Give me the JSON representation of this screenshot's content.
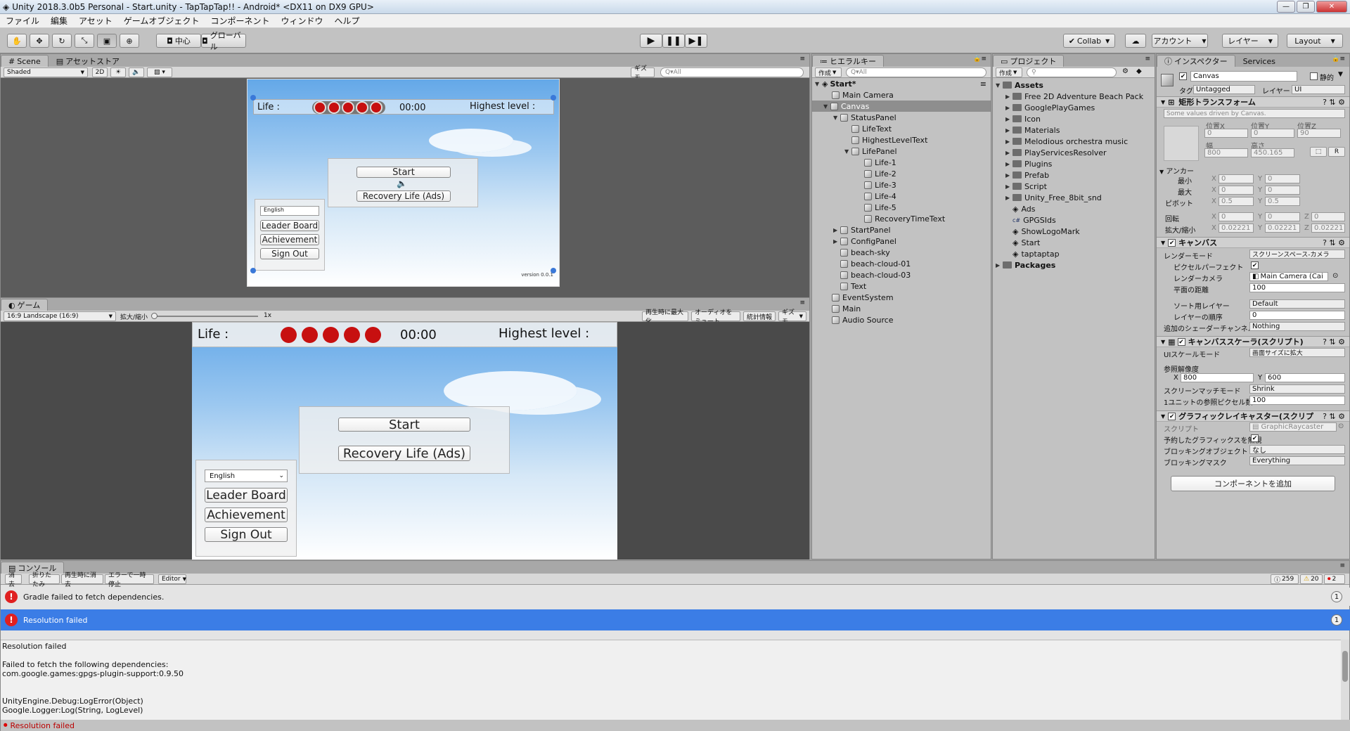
{
  "window": {
    "title": "Unity 2018.3.0b5 Personal - Start.unity - TapTapTap!! - Android* <DX11 on DX9 GPU>"
  },
  "menu": [
    "ファイル",
    "編集",
    "アセット",
    "ゲームオブジェクト",
    "コンポーネント",
    "ウィンドウ",
    "ヘルプ"
  ],
  "toolbar": {
    "pivot": "中心",
    "global": "グローバル",
    "collab": "Collab",
    "account": "アカウント",
    "layers": "レイヤー",
    "layout": "Layout"
  },
  "scene": {
    "tab_scene": "Scene",
    "tab_store": "アセットストア",
    "shading": "Shaded",
    "mode2d": "2D",
    "gizmos": "ギズモ",
    "search_placeholder": "Q▾All",
    "life_label": "Life :",
    "timer": "00:00",
    "highest": "Highest level :",
    "start": "Start",
    "recovery": "Recovery Life (Ads)",
    "language": "English",
    "leaderboard": "Leader Board",
    "achievement": "Achievement",
    "signout": "Sign Out",
    "version": "version 0.0.1"
  },
  "game": {
    "tab": "ゲーム",
    "resolution": "16:9 Landscape (16:9)",
    "scale_label": "拡大/縮小",
    "scale_value": "1x",
    "maximize": "再生時に最大化",
    "mute": "オーディオをミュート",
    "stats": "統計情報",
    "gizmos": "ギズモ",
    "life_label": "Life :",
    "timer": "00:00",
    "highest": "Highest level :",
    "start": "Start",
    "recovery": "Recovery Life (Ads)",
    "language": "English",
    "leaderboard": "Leader Board",
    "achievement": "Achievement",
    "signout": "Sign Out",
    "life_count": 5
  },
  "hierarchy": {
    "tab": "ヒエラルキー",
    "create": "作成",
    "search_placeholder": "Q▾All",
    "scene_name": "Start*",
    "items": [
      "Main Camera",
      "Canvas",
      "StatusPanel",
      "LifeText",
      "HighestLevelText",
      "LifePanel",
      "Life-1",
      "Life-2",
      "Life-3",
      "Life-4",
      "Life-5",
      "RecoveryTimeText",
      "StartPanel",
      "ConfigPanel",
      "beach-sky",
      "beach-cloud-01",
      "beach-cloud-03",
      "Text",
      "EventSystem",
      "Main",
      "Audio Source"
    ]
  },
  "project": {
    "tab": "プロジェクト",
    "create": "作成",
    "assets_label": "Assets",
    "packages_label": "Packages",
    "folders": [
      "Free 2D Adventure Beach Pack",
      "GooglePlayGames",
      "Icon",
      "Materials",
      "Melodious orchestra music",
      "Plugins",
      "Prefab",
      "Script",
      "Unity_Free_8bit_snd"
    ],
    "files": [
      "Ads",
      "GPGSIds",
      "ShowLogoMark",
      "Start",
      "taptaptap"
    ],
    "plugins_label": "PlayServicesResolver"
  },
  "inspector": {
    "tab": "インスペクター",
    "tab2": "Services",
    "object_name": "Canvas",
    "static_label": "静的",
    "tag_label": "タグ",
    "tag_value": "Untagged",
    "layer_label": "レイヤー",
    "layer_value": "UI",
    "rect_title": "矩形トランスフォーム",
    "rect_note": "Some values driven by Canvas.",
    "pos_x_label": "位置X",
    "pos_y_label": "位置Y",
    "pos_z_label": "位置Z",
    "pos_x": "0",
    "pos_y": "0",
    "pos_z": "90",
    "width_label": "幅",
    "height_label": "高さ",
    "width": "800",
    "height": "450.165",
    "anchor_label": "アンカー",
    "min_label": "最小",
    "max_label": "最大",
    "pivot_label": "ピボット",
    "min_x": "0",
    "min_y": "0",
    "max_x": "0",
    "max_y": "0",
    "pivot_x": "0.5",
    "pivot_y": "0.5",
    "rotation_label": "回転",
    "rot_x": "0",
    "rot_y": "0",
    "rot_z": "0",
    "scale_label": "拡大/縮小",
    "scale_x": "0.02221",
    "scale_y": "0.02221",
    "scale_z": "0.02221",
    "canvas_title": "キャンバス",
    "render_mode_label": "レンダーモード",
    "render_mode": "スクリーンスペース-カメラ",
    "pixel_perfect_label": "ピクセルパーフェクト",
    "render_camera_label": "レンダーカメラ",
    "render_camera": "Main Camera (Cai",
    "plane_distance_label": "平面の距離",
    "plane_distance": "100",
    "sorting_layer_label": "ソート用レイヤー",
    "sorting_layer": "Default",
    "order_label": "レイヤーの順序",
    "order": "0",
    "shader_channel_label": "追加のシェーダーチャンネル",
    "shader_channel": "Nothing",
    "scaler_title": "キャンバススケーラ(スクリプト)",
    "ui_scale_label": "UIスケールモード",
    "ui_scale": "画面サイズに拡大",
    "ref_res_label": "参照解像度",
    "ref_x": "800",
    "ref_y": "600",
    "match_label": "スクリーンマッチモード",
    "match": "Shrink",
    "ppu_label": "1ユニットの参照ピクセル数",
    "ppu": "100",
    "raycaster_title": "グラフィックレイキャスター(スクリプ",
    "script_label": "スクリプト",
    "script": "GraphicRaycaster",
    "ignore_reversed_label": "予約したグラフィックスを無視",
    "blocking_objects_label": "ブロッキングオブジェクト",
    "blocking_objects": "なし",
    "blocking_mask_label": "ブロッキングマスク",
    "blocking_mask": "Everything",
    "add_component": "コンポーネントを追加",
    "x": "X",
    "y": "Y",
    "z": "Z",
    "r": "R"
  },
  "console": {
    "tab": "コンソール",
    "clear": "消去",
    "collapse": "折りたたみ",
    "clear_on_play": "再生時に消去",
    "error_pause": "エラーで一時停止",
    "editor": "Editor",
    "count_log": "259",
    "count_warn": "20",
    "count_err": "2",
    "rows": [
      {
        "text": "Gradle failed to fetch dependencies.",
        "count": "1"
      },
      {
        "text": "Resolution failed",
        "count": "1"
      }
    ],
    "detail": [
      "Resolution failed",
      "",
      "Failed to fetch the following dependencies:",
      "com.google.games:gpgs-plugin-support:0.9.50",
      "",
      "",
      "UnityEngine.Debug:LogError(Object)",
      "Google.Logger:Log(String, LogLevel)"
    ],
    "status": "Resolution failed"
  }
}
